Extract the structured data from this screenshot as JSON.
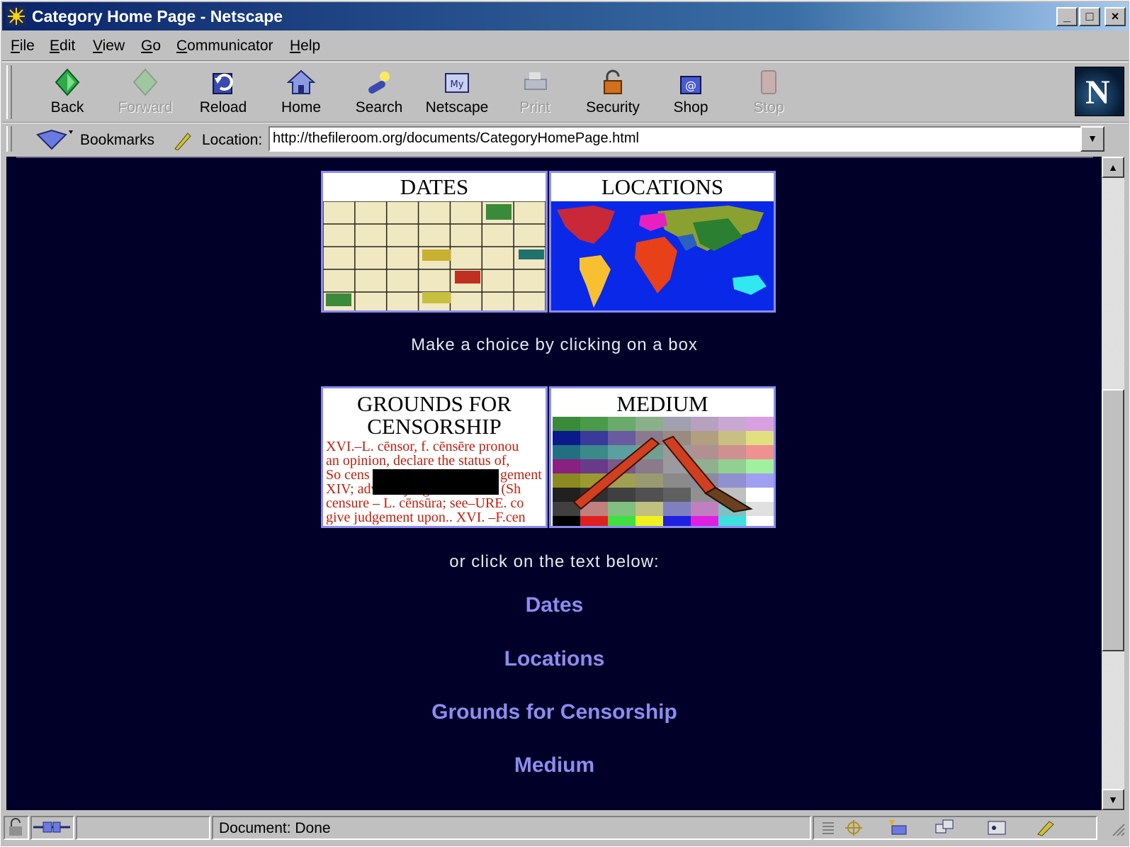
{
  "window": {
    "title": "Category Home Page - Netscape"
  },
  "menu": {
    "items": [
      {
        "label": "File",
        "u": "F",
        "rest": "ile"
      },
      {
        "label": "Edit",
        "u": "E",
        "rest": "dit"
      },
      {
        "label": "View",
        "u": "V",
        "rest": "iew"
      },
      {
        "label": "Go",
        "u": "G",
        "rest": "o"
      },
      {
        "label": "Communicator",
        "u": "C",
        "rest": "ommunicator"
      },
      {
        "label": "Help",
        "u": "H",
        "rest": "elp"
      }
    ]
  },
  "toolbar": {
    "buttons": [
      {
        "label": "Back",
        "icon": "back-arrow-icon",
        "enabled": true
      },
      {
        "label": "Forward",
        "icon": "forward-arrow-icon",
        "enabled": false
      },
      {
        "label": "Reload",
        "icon": "reload-icon",
        "enabled": true
      },
      {
        "label": "Home",
        "icon": "home-icon",
        "enabled": true
      },
      {
        "label": "Search",
        "icon": "search-icon",
        "enabled": true
      },
      {
        "label": "Netscape",
        "icon": "my-netscape-icon",
        "enabled": true
      },
      {
        "label": "Print",
        "icon": "print-icon",
        "enabled": false
      },
      {
        "label": "Security",
        "icon": "security-lock-icon",
        "enabled": true
      },
      {
        "label": "Shop",
        "icon": "shop-icon",
        "enabled": true
      },
      {
        "label": "Stop",
        "icon": "stop-icon",
        "enabled": false
      }
    ]
  },
  "location": {
    "bookmarks_label": "Bookmarks",
    "location_label": "Location:",
    "url": "http://thefileroom.org/documents/CategoryHomePage.html"
  },
  "content": {
    "tiles_top": [
      {
        "caption": "DATES"
      },
      {
        "caption": "LOCATIONS"
      }
    ],
    "tiles_bottom": [
      {
        "caption_line1": "GROUNDS FOR",
        "caption_line2": "CENSORSHIP",
        "text_lines": [
          "XVI.–L. cēnsor, f. cēnsēre pronou",
          "an opinion, declare the status of,",
          "So cens",
          "gement",
          "XIV; adverse judgement XVII (Sh",
          "censure – L. cēnsūra; see–URE. co",
          "give judgement upon.. XVI. –F.cen"
        ]
      },
      {
        "caption": "MEDIUM"
      }
    ],
    "instruction": "Make a choice by clicking on a box",
    "alt_instruction": "or click on the text below:",
    "links": [
      "Dates",
      "Locations",
      "Grounds for Censorship",
      "Medium"
    ]
  },
  "status": {
    "text": "Document: Done"
  },
  "colors": {
    "page_bg": "#000028",
    "link": "#8c8cf0",
    "tile_border": "#8c8cf0",
    "title_bar": "#0a246a"
  }
}
